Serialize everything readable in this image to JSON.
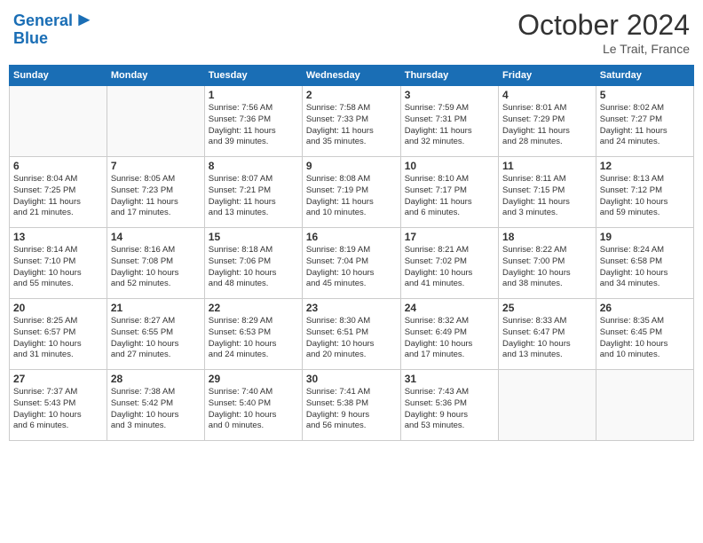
{
  "header": {
    "logo_line1": "General",
    "logo_line2": "Blue",
    "month": "October 2024",
    "location": "Le Trait, France"
  },
  "weekdays": [
    "Sunday",
    "Monday",
    "Tuesday",
    "Wednesday",
    "Thursday",
    "Friday",
    "Saturday"
  ],
  "weeks": [
    [
      {
        "day": "",
        "info": ""
      },
      {
        "day": "",
        "info": ""
      },
      {
        "day": "1",
        "info": "Sunrise: 7:56 AM\nSunset: 7:36 PM\nDaylight: 11 hours\nand 39 minutes."
      },
      {
        "day": "2",
        "info": "Sunrise: 7:58 AM\nSunset: 7:33 PM\nDaylight: 11 hours\nand 35 minutes."
      },
      {
        "day": "3",
        "info": "Sunrise: 7:59 AM\nSunset: 7:31 PM\nDaylight: 11 hours\nand 32 minutes."
      },
      {
        "day": "4",
        "info": "Sunrise: 8:01 AM\nSunset: 7:29 PM\nDaylight: 11 hours\nand 28 minutes."
      },
      {
        "day": "5",
        "info": "Sunrise: 8:02 AM\nSunset: 7:27 PM\nDaylight: 11 hours\nand 24 minutes."
      }
    ],
    [
      {
        "day": "6",
        "info": "Sunrise: 8:04 AM\nSunset: 7:25 PM\nDaylight: 11 hours\nand 21 minutes."
      },
      {
        "day": "7",
        "info": "Sunrise: 8:05 AM\nSunset: 7:23 PM\nDaylight: 11 hours\nand 17 minutes."
      },
      {
        "day": "8",
        "info": "Sunrise: 8:07 AM\nSunset: 7:21 PM\nDaylight: 11 hours\nand 13 minutes."
      },
      {
        "day": "9",
        "info": "Sunrise: 8:08 AM\nSunset: 7:19 PM\nDaylight: 11 hours\nand 10 minutes."
      },
      {
        "day": "10",
        "info": "Sunrise: 8:10 AM\nSunset: 7:17 PM\nDaylight: 11 hours\nand 6 minutes."
      },
      {
        "day": "11",
        "info": "Sunrise: 8:11 AM\nSunset: 7:15 PM\nDaylight: 11 hours\nand 3 minutes."
      },
      {
        "day": "12",
        "info": "Sunrise: 8:13 AM\nSunset: 7:12 PM\nDaylight: 10 hours\nand 59 minutes."
      }
    ],
    [
      {
        "day": "13",
        "info": "Sunrise: 8:14 AM\nSunset: 7:10 PM\nDaylight: 10 hours\nand 55 minutes."
      },
      {
        "day": "14",
        "info": "Sunrise: 8:16 AM\nSunset: 7:08 PM\nDaylight: 10 hours\nand 52 minutes."
      },
      {
        "day": "15",
        "info": "Sunrise: 8:18 AM\nSunset: 7:06 PM\nDaylight: 10 hours\nand 48 minutes."
      },
      {
        "day": "16",
        "info": "Sunrise: 8:19 AM\nSunset: 7:04 PM\nDaylight: 10 hours\nand 45 minutes."
      },
      {
        "day": "17",
        "info": "Sunrise: 8:21 AM\nSunset: 7:02 PM\nDaylight: 10 hours\nand 41 minutes."
      },
      {
        "day": "18",
        "info": "Sunrise: 8:22 AM\nSunset: 7:00 PM\nDaylight: 10 hours\nand 38 minutes."
      },
      {
        "day": "19",
        "info": "Sunrise: 8:24 AM\nSunset: 6:58 PM\nDaylight: 10 hours\nand 34 minutes."
      }
    ],
    [
      {
        "day": "20",
        "info": "Sunrise: 8:25 AM\nSunset: 6:57 PM\nDaylight: 10 hours\nand 31 minutes."
      },
      {
        "day": "21",
        "info": "Sunrise: 8:27 AM\nSunset: 6:55 PM\nDaylight: 10 hours\nand 27 minutes."
      },
      {
        "day": "22",
        "info": "Sunrise: 8:29 AM\nSunset: 6:53 PM\nDaylight: 10 hours\nand 24 minutes."
      },
      {
        "day": "23",
        "info": "Sunrise: 8:30 AM\nSunset: 6:51 PM\nDaylight: 10 hours\nand 20 minutes."
      },
      {
        "day": "24",
        "info": "Sunrise: 8:32 AM\nSunset: 6:49 PM\nDaylight: 10 hours\nand 17 minutes."
      },
      {
        "day": "25",
        "info": "Sunrise: 8:33 AM\nSunset: 6:47 PM\nDaylight: 10 hours\nand 13 minutes."
      },
      {
        "day": "26",
        "info": "Sunrise: 8:35 AM\nSunset: 6:45 PM\nDaylight: 10 hours\nand 10 minutes."
      }
    ],
    [
      {
        "day": "27",
        "info": "Sunrise: 7:37 AM\nSunset: 5:43 PM\nDaylight: 10 hours\nand 6 minutes."
      },
      {
        "day": "28",
        "info": "Sunrise: 7:38 AM\nSunset: 5:42 PM\nDaylight: 10 hours\nand 3 minutes."
      },
      {
        "day": "29",
        "info": "Sunrise: 7:40 AM\nSunset: 5:40 PM\nDaylight: 10 hours\nand 0 minutes."
      },
      {
        "day": "30",
        "info": "Sunrise: 7:41 AM\nSunset: 5:38 PM\nDaylight: 9 hours\nand 56 minutes."
      },
      {
        "day": "31",
        "info": "Sunrise: 7:43 AM\nSunset: 5:36 PM\nDaylight: 9 hours\nand 53 minutes."
      },
      {
        "day": "",
        "info": ""
      },
      {
        "day": "",
        "info": ""
      }
    ]
  ]
}
